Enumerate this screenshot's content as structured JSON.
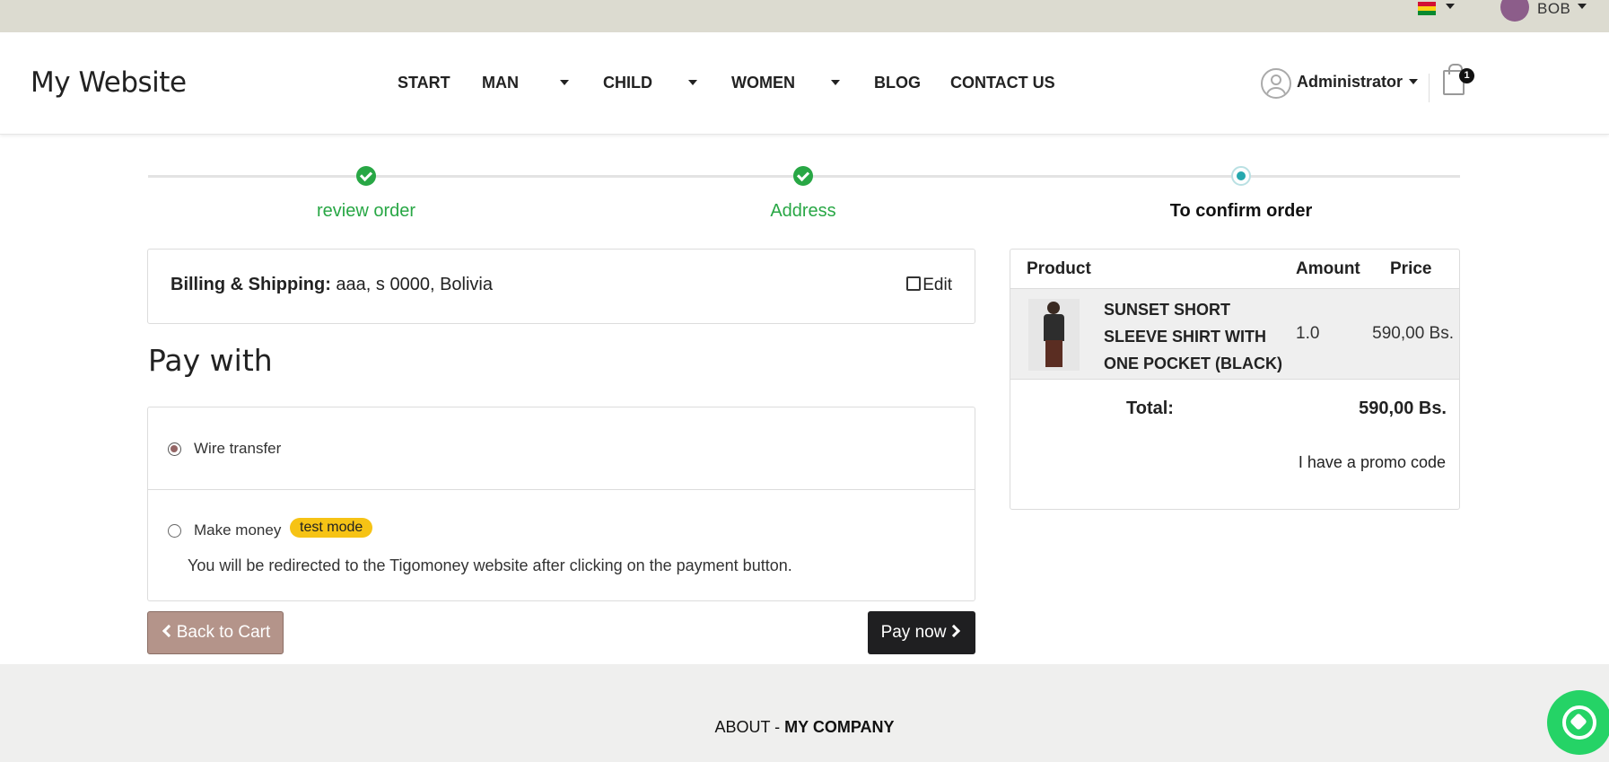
{
  "topbar": {
    "language_caret": "▾",
    "user_name": "BOB"
  },
  "header": {
    "logo": "My Website",
    "nav": [
      {
        "label": "START"
      },
      {
        "label": "MAN"
      },
      {
        "label": "CHILD"
      },
      {
        "label": "WOMEN"
      },
      {
        "label": "BLOG"
      },
      {
        "label": "CONTACT US"
      }
    ],
    "admin_name": "Administrator",
    "cart_count": "1"
  },
  "steps": [
    {
      "label": "review order",
      "state": "done"
    },
    {
      "label": "Address",
      "state": "done"
    },
    {
      "label": "To confirm order",
      "state": "current"
    }
  ],
  "billing": {
    "label": "Billing & Shipping:",
    "value": "aaa, s 0000, Bolivia",
    "edit_label": "Edit"
  },
  "payment": {
    "title": "Pay with",
    "methods": [
      {
        "label": "Wire transfer",
        "selected": true
      },
      {
        "label": "Make money",
        "selected": false,
        "badge": "test mode",
        "description": "You will be redirected to the Tigomoney website after clicking on the payment button."
      }
    ],
    "back_label": "Back to Cart",
    "pay_label": "Pay now"
  },
  "summary": {
    "headers": {
      "product": "Product",
      "amount": "Amount",
      "price": "Price"
    },
    "items": [
      {
        "name": "SUNSET SHORT SLEEVE SHIRT WITH ONE POCKET (BLACK)",
        "qty": "1.0",
        "price": "590,00 Bs."
      }
    ],
    "total_label": "Total:",
    "total_value": "590,00 Bs.",
    "promo_label": "I have a promo code"
  },
  "footer": {
    "about": "ABOUT -",
    "company": "MY COMPANY"
  },
  "colors": {
    "topbar": "#dcdbd0",
    "step_done": "#28a745",
    "step_current": "#25a8ae",
    "back_button": "#b4948a",
    "pay_button": "#1f1f21",
    "badge": "#f6c315",
    "whatsapp": "#25d366"
  },
  "icons": [
    "flag-icon",
    "user-avatar-icon",
    "admin-user-icon",
    "cart-icon",
    "check-icon",
    "edit-icon",
    "chevron-left-icon",
    "chevron-right-icon",
    "whatsapp-icon"
  ]
}
